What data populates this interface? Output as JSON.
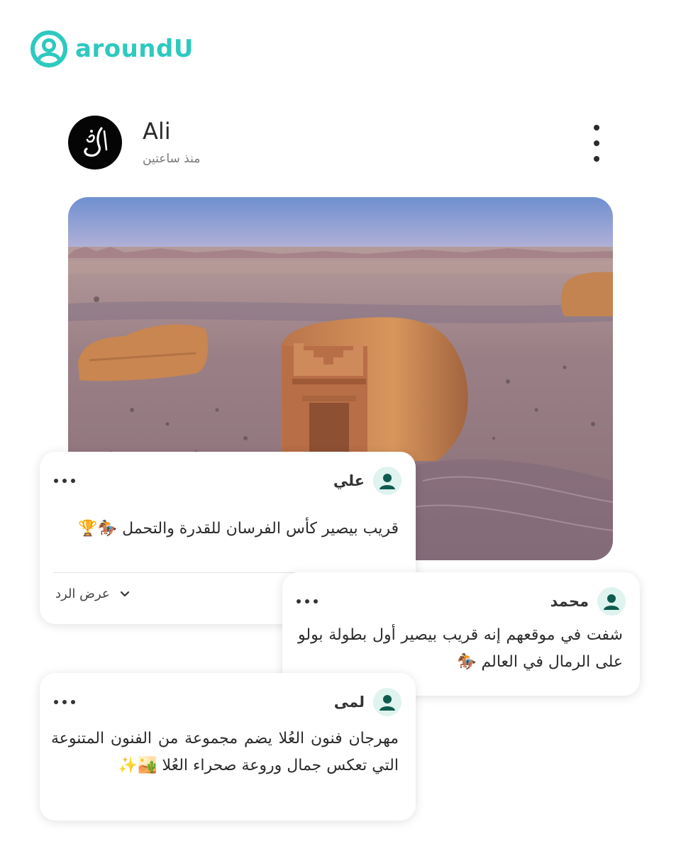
{
  "brand": {
    "name": "aroundU",
    "color": "#2ec9bf"
  },
  "post": {
    "author": "Ali",
    "time": "منذ ساعتين",
    "avatar_icon": "calligraphy-logo-icon",
    "menu_icon": "more-vertical-icon"
  },
  "comments": [
    {
      "name": "علي",
      "text": "قريب بيصير كأس الفرسان للقدرة والتحمل 🏇🏆",
      "reply_label": "عرض الرد"
    },
    {
      "name": "محمد",
      "text": "شفت في موقعهم إنه قريب بيصير أول بطولة بولو على الرمال في العالم 🏇"
    },
    {
      "name": "لمى",
      "text": "مهرجان فنون العُلا يضم مجموعة من الفنون المتنوعة التي تعكس جمال وروعة صحراء العُلا 🏜️✨"
    }
  ],
  "colors": {
    "accent": "#2ec9bf",
    "avatar_bg": "#dff3ef",
    "avatar_fg": "#0f5b4f"
  }
}
